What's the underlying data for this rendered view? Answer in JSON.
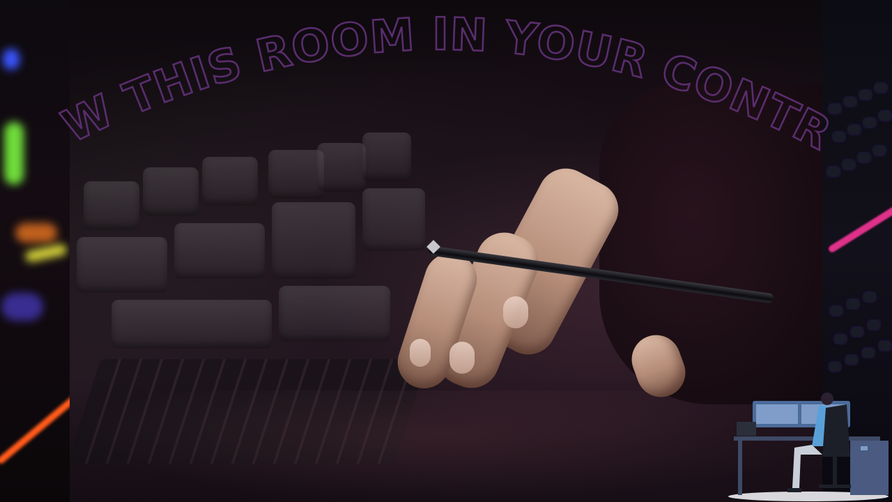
{
  "headline": {
    "text": "NOW THIS ROOM IN YOUR CONTROL"
  },
  "colors": {
    "headline_stroke": "#5a2d6e",
    "accent_pink": "#e0318a",
    "accent_green": "#7be04a",
    "accent_orange": "#ff6a1a"
  },
  "illustration": {
    "subject": "person-at-computer-desk"
  }
}
